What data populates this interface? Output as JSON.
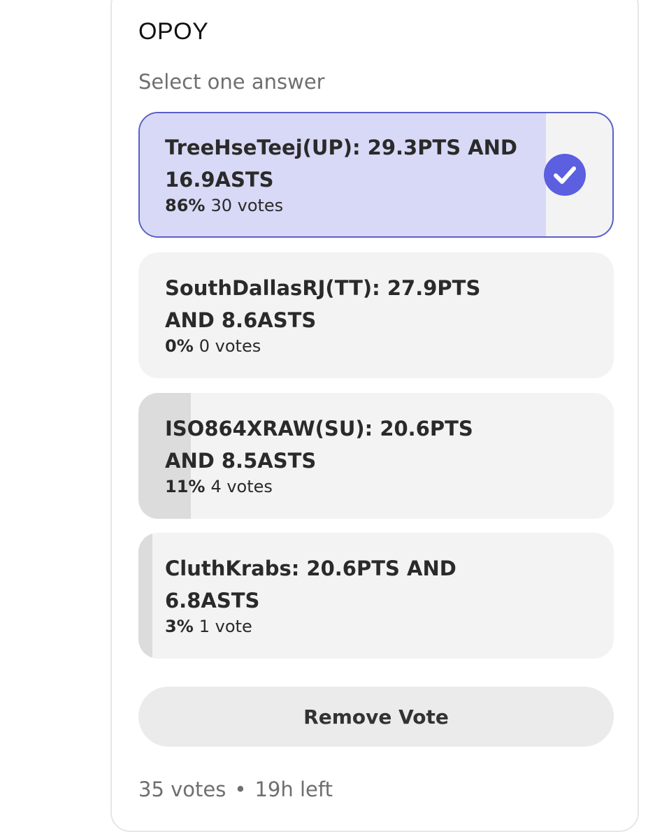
{
  "poll": {
    "title": "OPOY",
    "subtitle": "Select one answer",
    "options": [
      {
        "label": "TreeHseTeej(UP): 29.3PTS AND 16.9ASTS",
        "percent": "86%",
        "votes": "30 votes",
        "fraction": 0.86,
        "selected": true
      },
      {
        "label": "SouthDallasRJ(TT): 27.9PTS AND 8.6ASTS",
        "percent": "0%",
        "votes": "0 votes",
        "fraction": 0.0,
        "selected": false
      },
      {
        "label": "ISO864XRAW(SU): 20.6PTS AND 8.5ASTS",
        "percent": "11%",
        "votes": "4 votes",
        "fraction": 0.11,
        "selected": false
      },
      {
        "label": "CluthKrabs: 20.6PTS AND 6.8ASTS",
        "percent": "3%",
        "votes": "1 vote",
        "fraction": 0.03,
        "selected": false
      }
    ],
    "remove_label": "Remove Vote",
    "footer": {
      "total": "35 votes",
      "separator": "•",
      "time_left": "19h left"
    }
  },
  "colors": {
    "accent": "#5b5fe0",
    "selected_fill": "#d8d9f6",
    "fill": "#dcdcdc",
    "option_bg": "#f3f3f3"
  },
  "icons": {
    "selected_indicator": "check-circle-icon"
  }
}
